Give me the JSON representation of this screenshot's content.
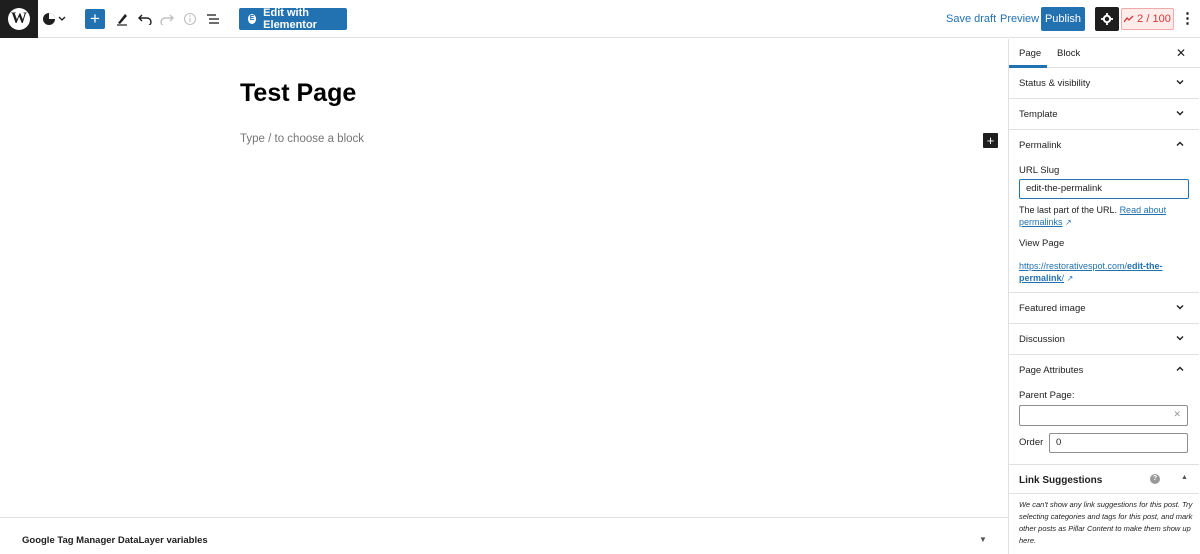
{
  "toolbar": {
    "wp_logo_icon": "wordpress-logo-icon",
    "edit_with_elementor": "Edit with Elementor",
    "save_draft": "Save draft",
    "preview": "Preview",
    "publish": "Publish",
    "score": "2 / 100"
  },
  "editor": {
    "page_title": "Test Page",
    "block_placeholder": "Type / to choose a block"
  },
  "metabox": {
    "title": "Google Tag Manager DataLayer variables"
  },
  "sidebar": {
    "tabs": {
      "page": "Page",
      "block": "Block"
    },
    "panels": {
      "status_visibility": "Status & visibility",
      "template": "Template",
      "permalink": "Permalink",
      "featured_image": "Featured image",
      "discussion": "Discussion",
      "page_attributes": "Page Attributes",
      "link_suggestions": "Link Suggestions"
    },
    "permalink": {
      "url_slug_label": "URL Slug",
      "url_slug_value": "edit-the-permalink",
      "help_prefix": "The last part of the URL.",
      "help_link": "Read about permalinks",
      "view_page_label": "View Page",
      "view_url_base": "https://restorativespot.com/",
      "view_url_slug": "edit-the-permalink",
      "view_url_suffix": "/"
    },
    "page_attributes": {
      "parent_page_label": "Parent Page:",
      "order_label": "Order",
      "order_value": "0"
    },
    "link_suggestions_text": "We can't show any link suggestions for this post. Try selecting categories and tags for this post, and mark other posts as Pillar Content to make them show up here."
  },
  "colors": {
    "accent": "#2271b1",
    "dark": "#1e1e1e",
    "score_red": "#d63638"
  }
}
